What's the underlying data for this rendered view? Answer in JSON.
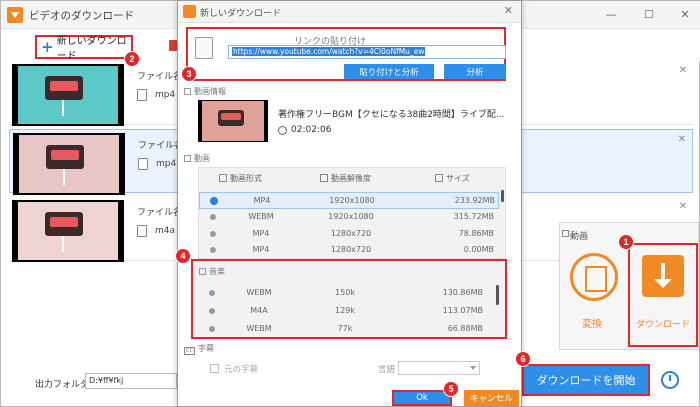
{
  "main": {
    "title": "ビデオのダウンロード",
    "win_minimize": "—",
    "win_maximize": "☐",
    "win_close": "✕",
    "new_download_label": "新しいダウンロード",
    "rows": [
      {
        "file_label": "ファイル名: 著",
        "format": "mp4",
        "close": "✕"
      },
      {
        "file_label": "ファイル名: 著",
        "format": "mp4",
        "close": "✕"
      },
      {
        "file_label": "ファイル名: 著",
        "format": "m4a",
        "close": "✕"
      }
    ],
    "output_folder_label": "出力フォルダ：",
    "output_folder_value": "D:¥ff¥fkj",
    "start_download_label": "ダウンロードを開始"
  },
  "panel": {
    "title": "動画",
    "convert_label": "変換",
    "download_label": "ダウンロード"
  },
  "dialog": {
    "title": "新しいダウンロード",
    "close": "✕",
    "paste_label": "リンクの貼り付け",
    "url": "https://www.youtube.com/watch?v=4Cl0oNfMu_ew",
    "paste_analyze_label": "貼り付けと分析",
    "analyze_label": "分析",
    "info_section": "動画情報",
    "video_title": "著作権フリーBGM【クセになる38曲2時間】ライブ配...",
    "duration": "02:02:06",
    "video_section": "動画",
    "columns": {
      "format": "動画形式",
      "resolution": "動画解像度",
      "size": "サイズ"
    },
    "video_rows": [
      {
        "format": "MP4",
        "resolution": "1920x1080",
        "size": "233.92MB",
        "selected": true
      },
      {
        "format": "WEBM",
        "resolution": "1920x1080",
        "size": "315.72MB",
        "selected": false
      },
      {
        "format": "MP4",
        "resolution": "1280x720",
        "size": "78.86MB",
        "selected": false
      },
      {
        "format": "MP4",
        "resolution": "1280x720",
        "size": "0.00MB",
        "selected": false
      }
    ],
    "audio_section": "音楽",
    "audio_rows": [
      {
        "format": "WEBM",
        "bitrate": "150k",
        "size": "130.86MB"
      },
      {
        "format": "M4A",
        "bitrate": "129k",
        "size": "113.07MB"
      },
      {
        "format": "WEBM",
        "bitrate": "77k",
        "size": "66.88MB"
      }
    ],
    "subtitle_section": "字幕",
    "original_subtitle_label": "元の字幕",
    "language_label": "言語",
    "ok_label": "Ok",
    "cancel_label": "キャンセル"
  },
  "markers": [
    "1",
    "2",
    "3",
    "4",
    "5",
    "6"
  ],
  "colors": {
    "accent_blue": "#2d8fe8",
    "accent_orange": "#f08a24",
    "highlight_red": "#e02828"
  }
}
